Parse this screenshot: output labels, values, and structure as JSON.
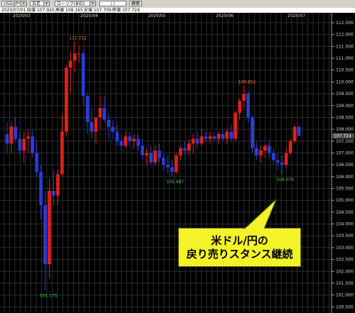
{
  "toolbar": {
    "symbol": "USD/JPY",
    "period": "日足",
    "candle_type": "ローソク(BID)",
    "date_input": "/  /",
    "search_label": "検索"
  },
  "ohlc": {
    "date": "2020/07/01",
    "open_label": "始値",
    "open": "107.920",
    "high_label": "高値",
    "high": "108.165",
    "low_label": "安値",
    "low": "107.709",
    "close_label": "終値",
    "close": "107.724"
  },
  "callout": {
    "line1": "米ドル/円の",
    "line2": "戻り売りスタンス継続"
  },
  "colors": {
    "bull": "#e0201a",
    "bear": "#2a3cd8",
    "background": "#000000",
    "grid": "#2c2c2c",
    "callout_fill": "#f3f32a"
  },
  "chart_data": {
    "type": "candlestick",
    "y_ticks": [
      "112.500",
      "112.000",
      "111.500",
      "111.000",
      "110.500",
      "110.000",
      "109.500",
      "109.000",
      "108.500",
      "108.000",
      "107.500",
      "107.000",
      "106.500",
      "106.000",
      "105.500",
      "105.000",
      "104.500",
      "104.000",
      "103.500",
      "103.000",
      "102.500",
      "102.000",
      "101.500",
      "101.000",
      "100.500"
    ],
    "ylim": [
      100.3,
      112.8
    ],
    "x_ticks": [
      "2020/03",
      "2020/04",
      "2020/05",
      "2020/06",
      "2020/07"
    ],
    "current_price": "107.724",
    "annotations": [
      {
        "text": "111.712",
        "kind": "high"
      },
      {
        "text": "101.175",
        "kind": "low"
      },
      {
        "text": "105.987",
        "kind": "low"
      },
      {
        "text": "109.852",
        "kind": "high"
      },
      {
        "text": "106.076",
        "kind": "low"
      }
    ],
    "candles": [
      {
        "o": 107.8,
        "h": 108.3,
        "l": 107.0,
        "c": 107.4
      },
      {
        "o": 107.4,
        "h": 108.3,
        "l": 107.0,
        "c": 108.1
      },
      {
        "o": 108.1,
        "h": 108.5,
        "l": 107.5,
        "c": 107.6
      },
      {
        "o": 107.6,
        "h": 107.9,
        "l": 106.9,
        "c": 107.1
      },
      {
        "o": 107.1,
        "h": 107.9,
        "l": 106.6,
        "c": 107.6
      },
      {
        "o": 107.6,
        "h": 108.0,
        "l": 107.0,
        "c": 107.7
      },
      {
        "o": 107.7,
        "h": 108.0,
        "l": 106.8,
        "c": 107.0
      },
      {
        "o": 107.0,
        "h": 107.5,
        "l": 106.0,
        "c": 106.2
      },
      {
        "o": 106.2,
        "h": 106.5,
        "l": 104.2,
        "c": 104.8
      },
      {
        "o": 104.8,
        "h": 105.4,
        "l": 101.18,
        "c": 102.3
      },
      {
        "o": 102.3,
        "h": 105.9,
        "l": 101.7,
        "c": 105.4
      },
      {
        "o": 105.4,
        "h": 106.3,
        "l": 104.8,
        "c": 105.2
      },
      {
        "o": 105.2,
        "h": 106.3,
        "l": 104.8,
        "c": 106.1
      },
      {
        "o": 106.1,
        "h": 108.6,
        "l": 106.0,
        "c": 107.9
      },
      {
        "o": 107.9,
        "h": 110.7,
        "l": 107.7,
        "c": 110.6
      },
      {
        "o": 110.6,
        "h": 111.3,
        "l": 109.5,
        "c": 110.9
      },
      {
        "o": 110.9,
        "h": 111.71,
        "l": 110.4,
        "c": 111.2
      },
      {
        "o": 111.2,
        "h": 111.5,
        "l": 110.8,
        "c": 111.2
      },
      {
        "o": 111.2,
        "h": 111.4,
        "l": 109.0,
        "c": 109.4
      },
      {
        "o": 109.4,
        "h": 109.6,
        "l": 107.8,
        "c": 108.3
      },
      {
        "o": 108.3,
        "h": 108.9,
        "l": 107.6,
        "c": 107.9
      },
      {
        "o": 107.9,
        "h": 108.5,
        "l": 107.4,
        "c": 108.5
      },
      {
        "o": 108.5,
        "h": 109.4,
        "l": 108.0,
        "c": 108.9
      },
      {
        "o": 108.9,
        "h": 109.4,
        "l": 108.3,
        "c": 108.4
      },
      {
        "o": 108.4,
        "h": 108.7,
        "l": 107.6,
        "c": 108.1
      },
      {
        "o": 108.1,
        "h": 108.4,
        "l": 107.6,
        "c": 107.9
      },
      {
        "o": 107.9,
        "h": 108.2,
        "l": 107.3,
        "c": 107.5
      },
      {
        "o": 107.5,
        "h": 107.8,
        "l": 107.1,
        "c": 107.3
      },
      {
        "o": 107.3,
        "h": 107.9,
        "l": 107.2,
        "c": 107.7
      },
      {
        "o": 107.7,
        "h": 107.9,
        "l": 107.3,
        "c": 107.5
      },
      {
        "o": 107.5,
        "h": 107.8,
        "l": 107.2,
        "c": 107.6
      },
      {
        "o": 107.6,
        "h": 107.8,
        "l": 107.1,
        "c": 107.3
      },
      {
        "o": 107.3,
        "h": 107.6,
        "l": 106.7,
        "c": 106.9
      },
      {
        "o": 106.9,
        "h": 107.2,
        "l": 106.5,
        "c": 107.0
      },
      {
        "o": 107.0,
        "h": 107.3,
        "l": 106.5,
        "c": 106.6
      },
      {
        "o": 106.6,
        "h": 107.3,
        "l": 106.5,
        "c": 107.1
      },
      {
        "o": 107.1,
        "h": 107.4,
        "l": 106.6,
        "c": 106.8
      },
      {
        "o": 106.8,
        "h": 107.0,
        "l": 106.3,
        "c": 106.5
      },
      {
        "o": 106.5,
        "h": 106.9,
        "l": 106.1,
        "c": 106.4
      },
      {
        "o": 106.4,
        "h": 106.7,
        "l": 105.99,
        "c": 106.2
      },
      {
        "o": 106.2,
        "h": 107.0,
        "l": 106.1,
        "c": 106.9
      },
      {
        "o": 106.9,
        "h": 107.3,
        "l": 106.7,
        "c": 107.2
      },
      {
        "o": 107.2,
        "h": 107.5,
        "l": 106.9,
        "c": 107.1
      },
      {
        "o": 107.1,
        "h": 107.6,
        "l": 106.9,
        "c": 107.4
      },
      {
        "o": 107.4,
        "h": 107.8,
        "l": 107.0,
        "c": 107.6
      },
      {
        "o": 107.6,
        "h": 107.9,
        "l": 107.2,
        "c": 107.4
      },
      {
        "o": 107.4,
        "h": 108.0,
        "l": 107.3,
        "c": 107.7
      },
      {
        "o": 107.7,
        "h": 107.9,
        "l": 107.5,
        "c": 107.6
      },
      {
        "o": 107.6,
        "h": 107.9,
        "l": 107.4,
        "c": 107.7
      },
      {
        "o": 107.7,
        "h": 107.9,
        "l": 107.5,
        "c": 107.6
      },
      {
        "o": 107.6,
        "h": 107.9,
        "l": 107.4,
        "c": 107.8
      },
      {
        "o": 107.8,
        "h": 108.0,
        "l": 107.5,
        "c": 107.6
      },
      {
        "o": 107.6,
        "h": 108.0,
        "l": 107.4,
        "c": 107.9
      },
      {
        "o": 107.9,
        "h": 108.2,
        "l": 107.5,
        "c": 107.6
      },
      {
        "o": 107.6,
        "h": 108.8,
        "l": 107.5,
        "c": 108.7
      },
      {
        "o": 108.7,
        "h": 109.3,
        "l": 108.4,
        "c": 109.2
      },
      {
        "o": 109.2,
        "h": 109.85,
        "l": 108.9,
        "c": 109.5
      },
      {
        "o": 109.5,
        "h": 109.6,
        "l": 108.3,
        "c": 108.5
      },
      {
        "o": 108.5,
        "h": 108.6,
        "l": 107.0,
        "c": 107.2
      },
      {
        "o": 107.2,
        "h": 107.5,
        "l": 106.7,
        "c": 106.9
      },
      {
        "o": 106.9,
        "h": 107.3,
        "l": 106.6,
        "c": 107.1
      },
      {
        "o": 107.1,
        "h": 107.4,
        "l": 106.8,
        "c": 107.3
      },
      {
        "o": 107.3,
        "h": 107.5,
        "l": 106.8,
        "c": 107.0
      },
      {
        "o": 107.0,
        "h": 107.2,
        "l": 106.5,
        "c": 106.7
      },
      {
        "o": 106.7,
        "h": 107.0,
        "l": 106.3,
        "c": 106.6
      },
      {
        "o": 106.6,
        "h": 106.9,
        "l": 106.08,
        "c": 106.5
      },
      {
        "o": 106.5,
        "h": 107.2,
        "l": 106.4,
        "c": 107.0
      },
      {
        "o": 107.0,
        "h": 107.6,
        "l": 106.9,
        "c": 107.5
      },
      {
        "o": 107.5,
        "h": 108.2,
        "l": 107.4,
        "c": 108.1
      },
      {
        "o": 108.1,
        "h": 108.17,
        "l": 107.71,
        "c": 107.72
      }
    ]
  }
}
